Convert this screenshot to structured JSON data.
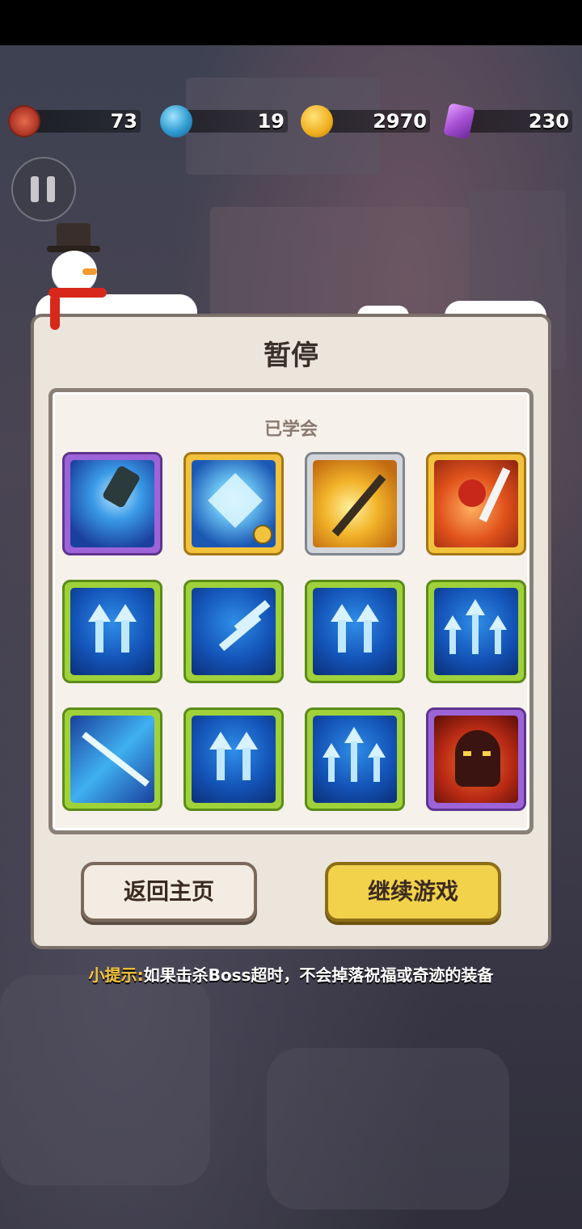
{
  "hud": {
    "resources": [
      {
        "name": "medal",
        "icon": "medal-icon",
        "value": "73",
        "color": "#c9483a"
      },
      {
        "name": "orb",
        "icon": "blue-orb-icon",
        "value": "19",
        "color": "#3fa8d8"
      },
      {
        "name": "coins",
        "icon": "coin-icon",
        "value": "2970",
        "color": "#f2b72a"
      },
      {
        "name": "gems",
        "icon": "purple-gem-icon",
        "value": "230",
        "color": "#a64fd0"
      }
    ]
  },
  "pause_dialog": {
    "title": "暂停",
    "section_label": "已学会",
    "skills": [
      {
        "icon": "water-cannon-skill-icon",
        "rarity": "purple"
      },
      {
        "icon": "ice-star-skill-icon",
        "rarity": "gold"
      },
      {
        "icon": "lightning-spear-skill-icon",
        "rarity": "silver"
      },
      {
        "icon": "fire-swordsman-skill-icon",
        "rarity": "gold"
      },
      {
        "icon": "double-arrow-up-icon",
        "rarity": "green"
      },
      {
        "icon": "diagonal-arrows-icon",
        "rarity": "green"
      },
      {
        "icon": "double-arrow-up-icon",
        "rarity": "green"
      },
      {
        "icon": "triple-arrow-up-icon",
        "rarity": "green"
      },
      {
        "icon": "piercing-arrows-icon",
        "rarity": "green"
      },
      {
        "icon": "double-arrow-up-icon",
        "rarity": "green"
      },
      {
        "icon": "triple-arrow-up-icon",
        "rarity": "green"
      },
      {
        "icon": "hooded-fire-mage-icon",
        "rarity": "purple"
      }
    ],
    "home_button": "返回主页",
    "continue_button": "继续游戏"
  },
  "tip": {
    "label": "小提示:",
    "text": "如果击杀Boss超时，不会掉落祝福或奇迹的装备"
  }
}
